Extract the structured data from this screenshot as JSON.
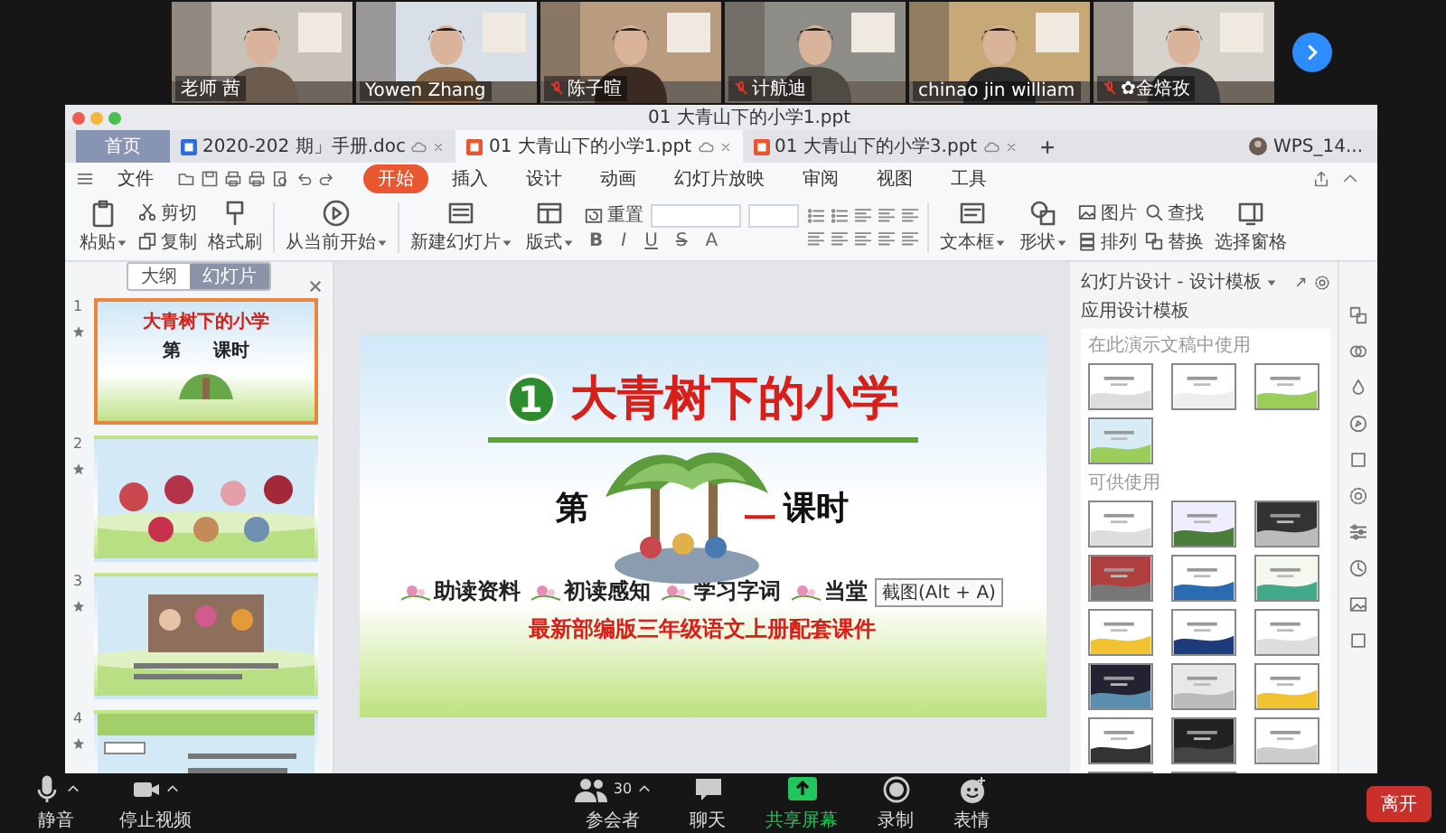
{
  "meeting": {
    "video_tiles": [
      {
        "name": "老师 茜",
        "muted": false
      },
      {
        "name": "Yowen Zhang",
        "muted": false
      },
      {
        "name": "陈子暄",
        "muted": true
      },
      {
        "name": "计航迪",
        "muted": true
      },
      {
        "name": "chinao jin william",
        "muted": false
      },
      {
        "name": "✿金焙孜",
        "muted": true
      }
    ]
  },
  "window": {
    "title": "01 大青山下的小学1.ppt"
  },
  "tabs": [
    {
      "label": "首页",
      "kind": "home",
      "selected": false
    },
    {
      "label": "2020-202 期」手册.doc",
      "kind": "doc",
      "selected": false
    },
    {
      "label": "01 大青山下的小学1.ppt",
      "kind": "ppt",
      "selected": true
    },
    {
      "label": "01 大青山下的小学3.ppt",
      "kind": "ppt",
      "selected": false
    }
  ],
  "account": {
    "name": "WPS_14..."
  },
  "file_menu": "文件",
  "ribbon_tabs": [
    {
      "label": "开始",
      "selected": true
    },
    {
      "label": "插入",
      "selected": false
    },
    {
      "label": "设计",
      "selected": false
    },
    {
      "label": "动画",
      "selected": false
    },
    {
      "label": "幻灯片放映",
      "selected": false
    },
    {
      "label": "审阅",
      "selected": false
    },
    {
      "label": "视图",
      "selected": false
    },
    {
      "label": "工具",
      "selected": false
    }
  ],
  "ribbon": [
    {
      "kind": "large",
      "label": "粘贴",
      "dropdown": true
    },
    {
      "kind": "stack",
      "items": [
        {
          "label": "剪切"
        },
        {
          "label": "复制"
        }
      ]
    },
    {
      "kind": "large",
      "label": "格式刷",
      "dropdown": false
    },
    {
      "kind": "large",
      "label": "从当前开始",
      "dropdown": true
    },
    {
      "kind": "large",
      "label": "新建幻灯片",
      "dropdown": true
    },
    {
      "kind": "large",
      "label": "版式",
      "dropdown": true
    },
    {
      "kind": "font",
      "reset": "重置",
      "buttons": [
        "B",
        "I",
        "U",
        "S",
        "A"
      ]
    },
    {
      "kind": "paragraph"
    },
    {
      "kind": "large",
      "label": "文本框",
      "dropdown": true
    },
    {
      "kind": "large",
      "label": "形状",
      "dropdown": true
    },
    {
      "kind": "stack",
      "items": [
        {
          "label": "图片"
        },
        {
          "label": "排列"
        }
      ]
    },
    {
      "kind": "stack",
      "items": [
        {
          "label": "查找"
        },
        {
          "label": "替换"
        }
      ]
    },
    {
      "kind": "large",
      "label": "选择窗格",
      "dropdown": false
    }
  ],
  "slide_panel": {
    "tabs": [
      {
        "label": "大纲",
        "selected": false
      },
      {
        "label": "幻灯片",
        "selected": true
      }
    ],
    "slides": [
      {
        "number": "1",
        "selected": true,
        "kind": "title",
        "title": "大青树下的小学",
        "lesson_left": "第",
        "lesson_right": "课时"
      },
      {
        "number": "2",
        "selected": false,
        "kind": "picture"
      },
      {
        "number": "3",
        "selected": false,
        "kind": "picture"
      },
      {
        "number": "4",
        "selected": false,
        "kind": "picture"
      }
    ]
  },
  "slide": {
    "number": "1",
    "title": "大青树下的小学",
    "lesson_left": "第",
    "lesson_mid": "一",
    "lesson_right": "课时",
    "topics": [
      "助读资料",
      "初读感知",
      "学习字词",
      "当堂"
    ],
    "footer": "最新部编版三年级语文上册配套课件",
    "tooltip": "截图(Alt + A)"
  },
  "design_panel": {
    "title": "幻灯片设计 - 设计模板",
    "heading": "应用设计模板",
    "in_use_label": "在此演示文稿中使用",
    "available_label": "可供使用"
  },
  "toolbar": [
    {
      "kind": "mute",
      "label": "静音",
      "menu": true
    },
    {
      "kind": "video",
      "label": "停止视频",
      "menu": true
    },
    {
      "kind": "participants",
      "label": "参会者",
      "count": "30",
      "menu": true
    },
    {
      "kind": "chat",
      "label": "聊天",
      "menu": false
    },
    {
      "kind": "share",
      "label": "共享屏幕",
      "menu": false
    },
    {
      "kind": "record",
      "label": "录制",
      "menu": false
    },
    {
      "kind": "reactions",
      "label": "表情",
      "menu": false
    }
  ],
  "leave_button": "离开"
}
